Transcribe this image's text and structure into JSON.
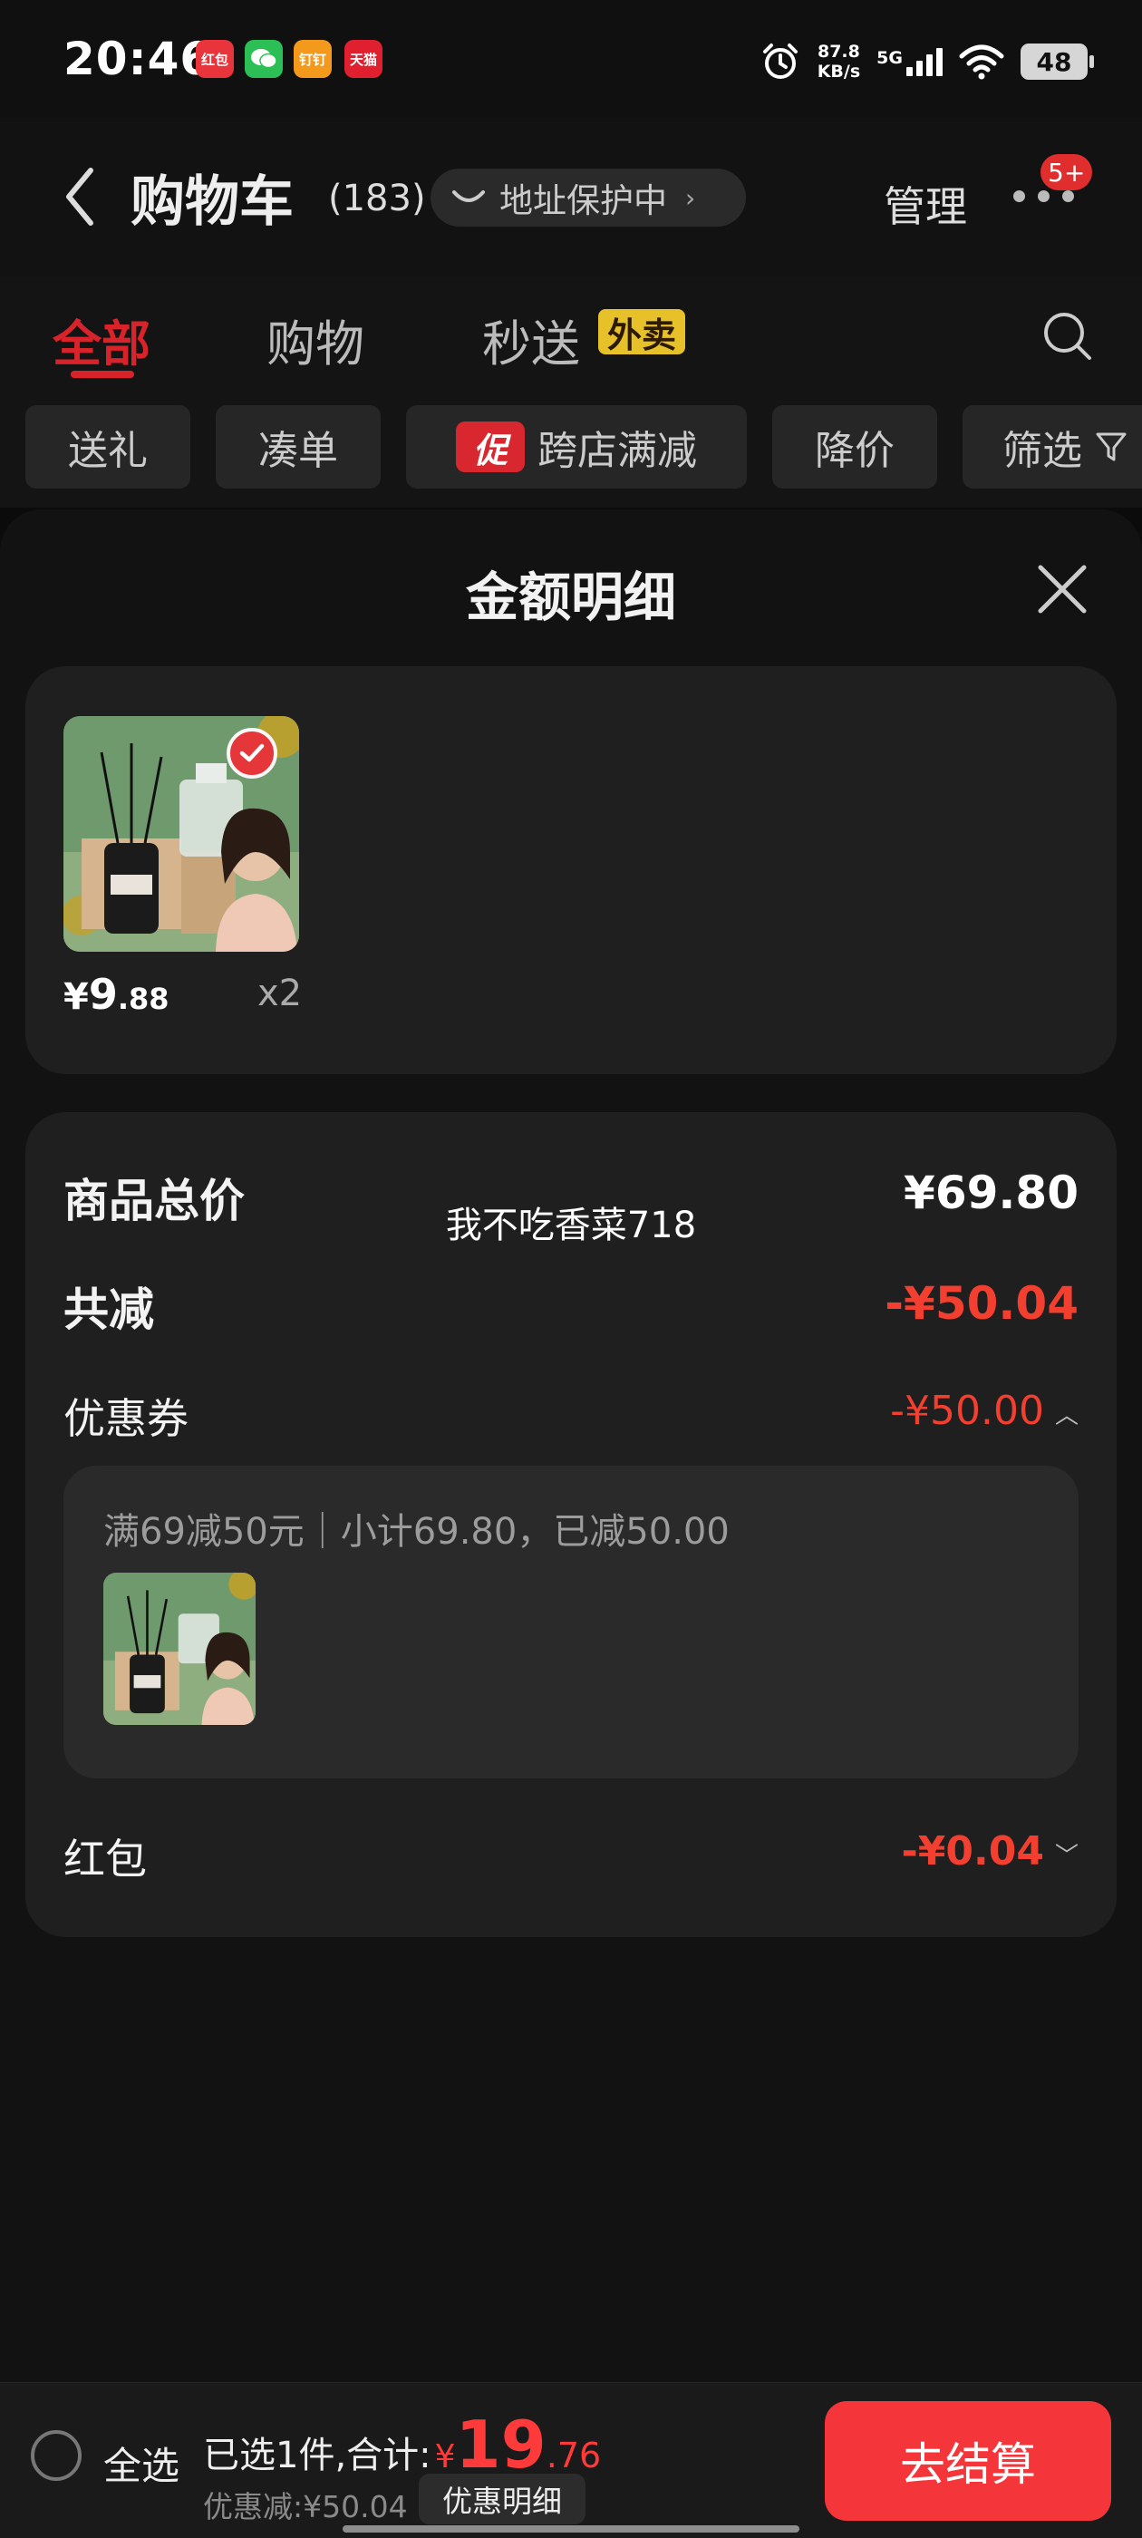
{
  "status_bar": {
    "time": "20:46",
    "apps": [
      "红包",
      "微信",
      "钉钉",
      "天猫"
    ],
    "net_speed_value": "87.8",
    "net_speed_unit": "KB/s",
    "network": "5G",
    "battery": "48",
    "icons": [
      "alarm-icon",
      "signal-icon",
      "wifi-icon",
      "battery-icon"
    ]
  },
  "header": {
    "title": "购物车",
    "count": "(183)",
    "address_protect": "地址保护中",
    "manage": "管理",
    "badge": "5+"
  },
  "tabs": {
    "items": [
      "全部",
      "购物",
      "秒送"
    ],
    "waimai": "外卖",
    "active": "全部"
  },
  "filters": {
    "gift": "送礼",
    "combine": "凑单",
    "promo_badge": "促",
    "cross_store": "跨店满减",
    "price_drop": "降价",
    "filter": "筛选"
  },
  "sheet": {
    "title": "金额明细",
    "product": {
      "currency": "¥",
      "price_int": "9",
      "price_dec": ".88",
      "qty": "x2"
    },
    "overlay_name": "我不吃香菜718",
    "rows": {
      "total_label": "商品总价",
      "total_value": "¥69.80",
      "reduce_label": "共减",
      "reduce_value": "-¥50.04",
      "coupon_label": "优惠券",
      "coupon_value": "-¥50.00",
      "coupon_detail": "满69减50元｜小计69.80，已减50.00",
      "redpack_label": "红包",
      "redpack_value": "-¥0.04"
    }
  },
  "bottom": {
    "select_all": "全选",
    "selected_text": "已选1件,合计:",
    "currency": "¥",
    "total_int": "19",
    "total_dec": ".76",
    "discount_text": "优惠减:¥50.04",
    "detail_button": "优惠明细",
    "checkout": "去结算"
  },
  "colors": {
    "accent_red": "#f4363b",
    "price_red": "#f23f2f",
    "waimai_yellow": "#e6c12a"
  }
}
